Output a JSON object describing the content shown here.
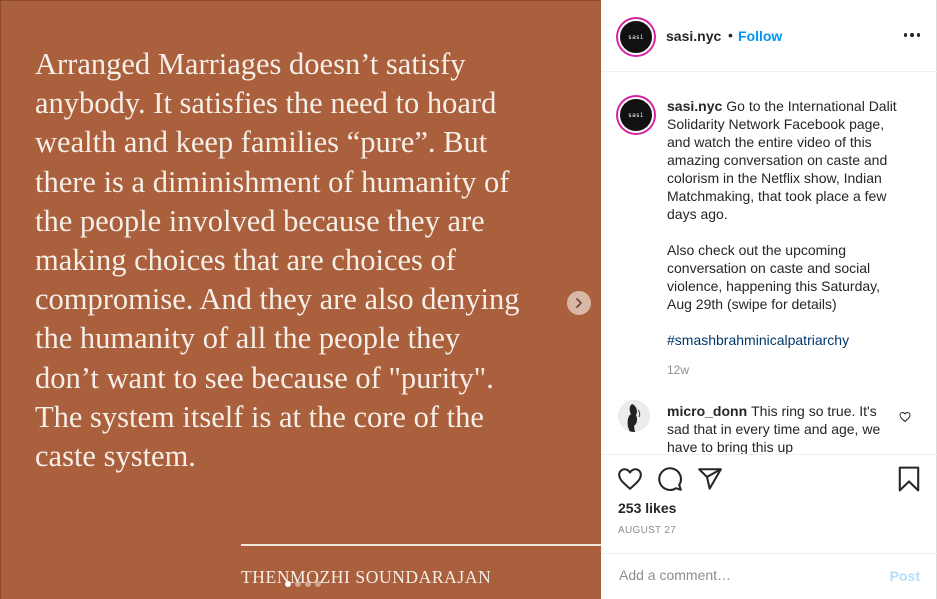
{
  "post_image": {
    "quote": "Arranged Marriages doesn’t satisfy\nanybody. It satisfies the need to hoard\nwealth and keep families “pure”. But\nthere is a diminishment of humanity of\nthe people involved because they are\nmaking choices that are choices of\ncompromise. And they are also denying\nthe humanity of all the people they\ndon’t want to see because of \"purity\".\nThe system itself is at the core of the\ncaste system.",
    "author": "THENMOZHI SOUNDARAJAN",
    "background_color": "#aa5f3d",
    "carousel_dots": 4,
    "active_dot": 0,
    "next_icon": "chevron-right-icon"
  },
  "header": {
    "avatar_text": "sasi",
    "username": "sasi.nyc",
    "separator": "•",
    "follow_label": "Follow",
    "more_icon": "more-horizontal-icon"
  },
  "caption": {
    "username": "sasi.nyc",
    "text": "Go to the International Dalit Solidarity Network Facebook page, and watch the entire video of this amazing conversation on caste and colorism in the Netflix show, Indian Matchmaking, that took place a few days ago.",
    "text2": "Also check out the upcoming conversation on caste and social violence, happening this Saturday, Aug 29th (swipe for details)",
    "hashtag": "#smashbrahminicalpatriarchy",
    "time": "12w"
  },
  "comment": {
    "username": "micro_donn",
    "text": "This ring so true. It's sad that in every time and age, we have to bring this up"
  },
  "actions": {
    "like_icon": "heart-icon",
    "comment_icon": "comment-icon",
    "share_icon": "share-icon",
    "save_icon": "bookmark-icon",
    "likes": "253 likes",
    "date": "AUGUST 27"
  },
  "add_comment": {
    "placeholder": "Add a comment…",
    "post_label": "Post"
  },
  "colors": {
    "link_blue": "#0095f6",
    "hashtag": "#00376b",
    "post_disabled": "#b2dffc"
  }
}
